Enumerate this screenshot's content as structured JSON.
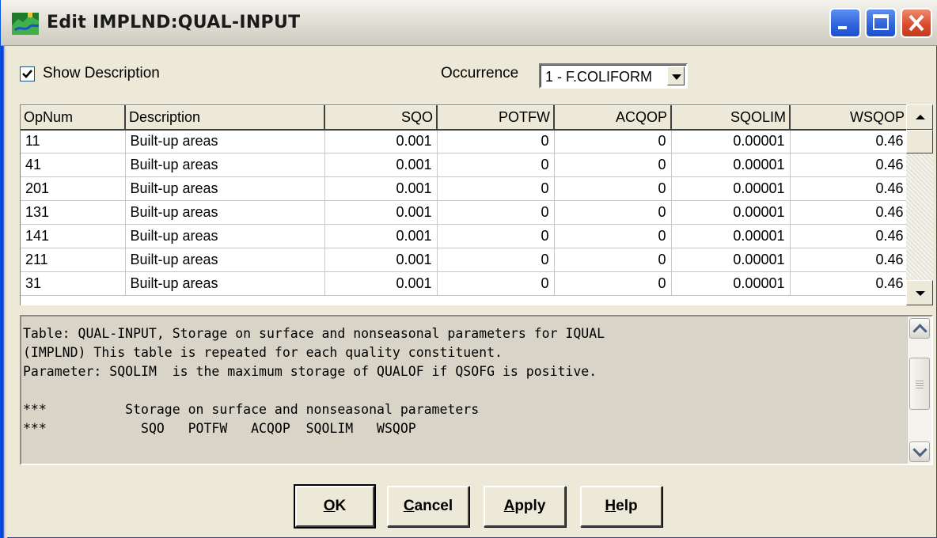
{
  "window": {
    "title": "Edit IMPLND:QUAL-INPUT",
    "controls": [
      "minimize",
      "maximize",
      "close"
    ]
  },
  "options": {
    "show_description_label": "Show Description",
    "show_description_checked": true,
    "occurrence_label": "Occurrence",
    "occurrence_value": "1 - F.COLIFORM"
  },
  "grid": {
    "columns": [
      "OpNum",
      "Description",
      "SQO",
      "POTFW",
      "ACQOP",
      "SQOLIM",
      "WSQOP"
    ],
    "rows": [
      [
        "11",
        "Built-up areas",
        "0.001",
        "0",
        "0",
        "0.00001",
        "0.46"
      ],
      [
        "41",
        "Built-up areas",
        "0.001",
        "0",
        "0",
        "0.00001",
        "0.46"
      ],
      [
        "201",
        "Built-up areas",
        "0.001",
        "0",
        "0",
        "0.00001",
        "0.46"
      ],
      [
        "131",
        "Built-up areas",
        "0.001",
        "0",
        "0",
        "0.00001",
        "0.46"
      ],
      [
        "141",
        "Built-up areas",
        "0.001",
        "0",
        "0",
        "0.00001",
        "0.46"
      ],
      [
        "211",
        "Built-up areas",
        "0.001",
        "0",
        "0",
        "0.00001",
        "0.46"
      ],
      [
        "31",
        "Built-up areas",
        "0.001",
        "0",
        "0",
        "0.00001",
        "0.46"
      ]
    ]
  },
  "description": {
    "lines": [
      "Table: QUAL-INPUT, Storage on surface and nonseasonal parameters for IQUAL",
      "(IMPLND) This table is repeated for each quality constituent.",
      "Parameter: SQOLIM  is the maximum storage of QUALOF if QSOFG is positive.",
      "",
      "***          Storage on surface and nonseasonal parameters",
      "***            SQO   POTFW   ACQOP  SQOLIM   WSQOP"
    ]
  },
  "buttons": {
    "ok": {
      "mnemonic": "O",
      "rest": "K"
    },
    "cancel": {
      "mnemonic": "C",
      "rest": "ancel"
    },
    "apply": {
      "mnemonic": "A",
      "rest": "pply"
    },
    "help": {
      "mnemonic": "H",
      "rest": "elp"
    }
  },
  "colors": {
    "face": "#ece9d8",
    "title_close": "#d9482a",
    "title_buttons": "#2e63dc"
  }
}
